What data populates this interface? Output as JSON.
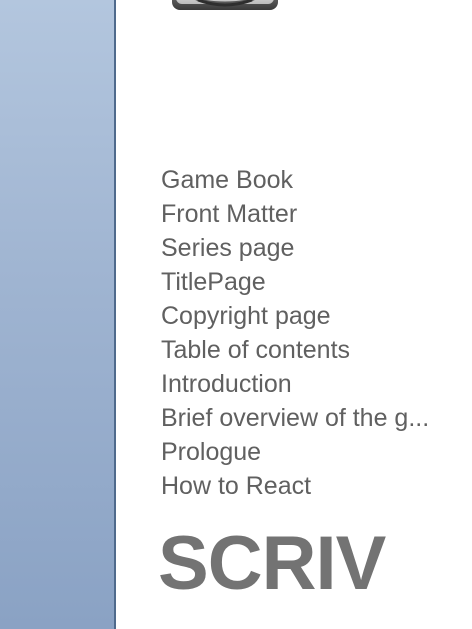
{
  "sidebar": {
    "colors": {
      "top": "#b3c6de",
      "bottom": "#8aa2c4",
      "border": "#4f6a8c"
    }
  },
  "app_icon": {
    "icon": "app-logo-icon"
  },
  "toc": {
    "items": [
      {
        "label": "Game Book"
      },
      {
        "label": "Front Matter"
      },
      {
        "label": "Series page"
      },
      {
        "label": "TitlePage"
      },
      {
        "label": "Copyright page"
      },
      {
        "label": "Table of contents"
      },
      {
        "label": "Introduction"
      },
      {
        "label": "Brief overview of the g..."
      },
      {
        "label": "Prologue"
      },
      {
        "label": "How to React"
      }
    ]
  },
  "logo_text": "SCRIV"
}
